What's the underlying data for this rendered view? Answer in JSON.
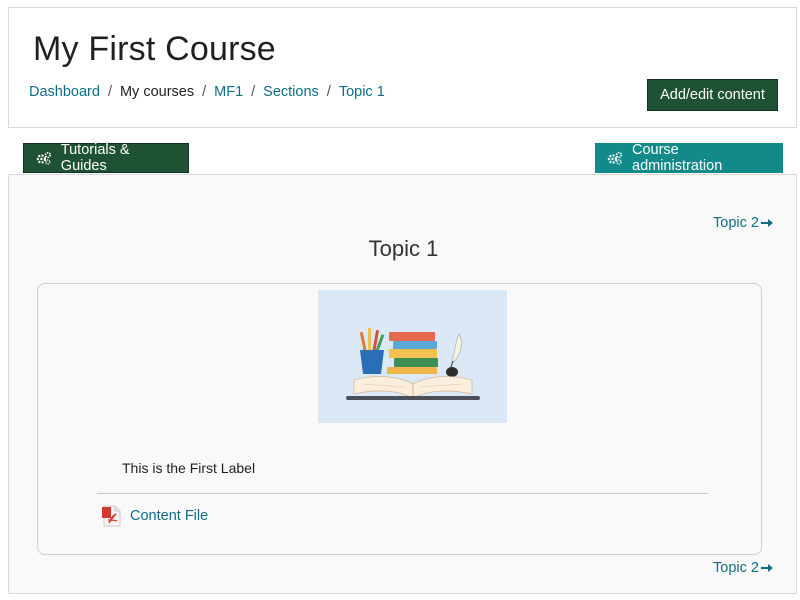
{
  "header": {
    "title": "My First Course",
    "breadcrumb": [
      {
        "label": "Dashboard",
        "link": true
      },
      {
        "label": "My courses",
        "link": false
      },
      {
        "label": "MF1",
        "link": true
      },
      {
        "label": "Sections",
        "link": true
      },
      {
        "label": "Topic 1",
        "link": true
      }
    ],
    "breadcrumb_separator": "/",
    "add_edit_label": "Add/edit content"
  },
  "toolbar": {
    "tutorials_label": "Tutorials & Guides",
    "admin_label": "Course administration",
    "icon": "gears-icon"
  },
  "section": {
    "title": "Topic 1",
    "next_link_top": "Topic 2",
    "next_link_bottom": "Topic 2",
    "label_text": "This is the First Label",
    "file_label": "Content File",
    "file_icon": "pdf-icon",
    "image_icon": "books-illustration"
  },
  "colors": {
    "primary_dark_green": "#1f5134",
    "teal": "#128a8a",
    "link": "#0f6e84",
    "image_bg": "#dbe9f7"
  }
}
